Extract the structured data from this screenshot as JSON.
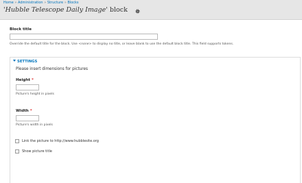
{
  "breadcrumb": {
    "items": [
      "Home",
      "Administration",
      "Structure",
      "Blocks"
    ],
    "separator": "»"
  },
  "page_title": {
    "open_quote": "'",
    "name": "Hubble Telescope Daily Image",
    "close_quote": "'",
    "suffix": " block",
    "gear_icon": "gear-icon"
  },
  "block_title": {
    "label": "Block title",
    "value": "",
    "description_pre": "Override the default title for the block. Use ",
    "description_code": "<none>",
    "description_post": " to display no title, or leave blank to use the default block title. This field supports tokens."
  },
  "settings": {
    "legend": "SETTINGS",
    "intro": "Please insert dimensions for pictures",
    "height": {
      "label": "Height",
      "required_mark": "*",
      "value": "",
      "description": "Picture's height in pixels"
    },
    "width": {
      "label": "Width",
      "required_mark": "*",
      "value": "",
      "description": "Picture's width in pixels"
    },
    "link_checkbox": {
      "label": "Link the picture to http://www.hubblesite.org",
      "checked": false
    },
    "show_title_checkbox": {
      "label": "Show picture title",
      "checked": false
    }
  },
  "colors": {
    "link": "#0074bd",
    "required": "#e03b3b",
    "header_bg": "#e6e6e6"
  }
}
